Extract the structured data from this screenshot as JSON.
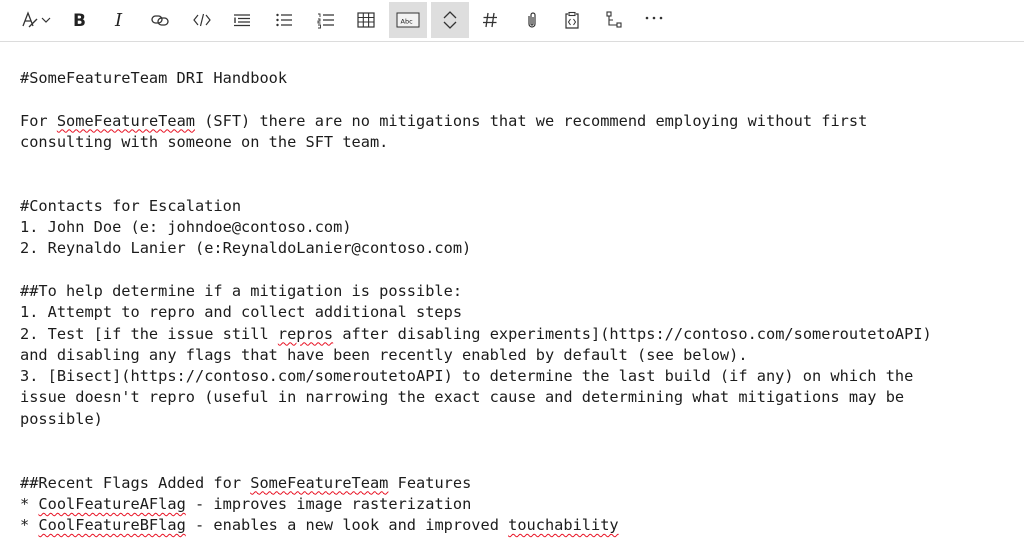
{
  "toolbar": {
    "icons": [
      "format-text-icon",
      "chevron-down-icon",
      "bold-icon",
      "italic-icon",
      "link-icon",
      "code-icon",
      "quote-icon",
      "bulleted-list-icon",
      "numbered-list-icon",
      "table-icon",
      "text-highlight-icon",
      "expand-collapse-icon",
      "heading-icon",
      "attach-icon",
      "paste-code-icon",
      "mention-pr-icon",
      "more-icon"
    ],
    "highlight_label": "Abc"
  },
  "document": {
    "title": "#SomeFeatureTeam DRI Handbook",
    "intro": {
      "part1": "For ",
      "team": "SomeFeatureTeam",
      "part2": " (SFT) there are no mitigations that we recommend employing without first",
      "line2": "consulting with someone on the SFT team."
    },
    "contacts_heading": "#Contacts for Escalation",
    "contacts": [
      "1. John Doe (e: johndoe@contoso.com)",
      "2. Reynaldo Lanier (e:ReynaldoLanier@contoso.com)"
    ],
    "mitigation_heading": "##To help determine if a mitigation is possible:",
    "step1": "1. Attempt to repro and collect additional steps",
    "step2": {
      "part1": "2. Test [if the issue still ",
      "repros": "repros",
      "part2": " after disabling experiments](https://contoso.com/someroutetoAPI)",
      "line2": "and disabling any flags that have been recently enabled by default (see below)."
    },
    "step3": {
      "line1": "3. [Bisect](https://contoso.com/someroutetoAPI) to determine the last build (if any) on which the",
      "line2": "issue doesn't repro (useful in narrowing the exact cause and determining what mitigations may be",
      "line3": "possible)"
    },
    "flags_heading": {
      "part1": "##Recent Flags Added for ",
      "team": "SomeFeatureTeam",
      "part2": " Features"
    },
    "flags": [
      {
        "bullet": "* ",
        "name": "CoolFeatureAFlag",
        "desc": " - improves image rasterization",
        "desc_tail": ""
      },
      {
        "bullet": "* ",
        "name": "CoolFeatureBFlag",
        "desc": " - enables a new look and improved ",
        "desc_tail": "touchability"
      }
    ]
  }
}
